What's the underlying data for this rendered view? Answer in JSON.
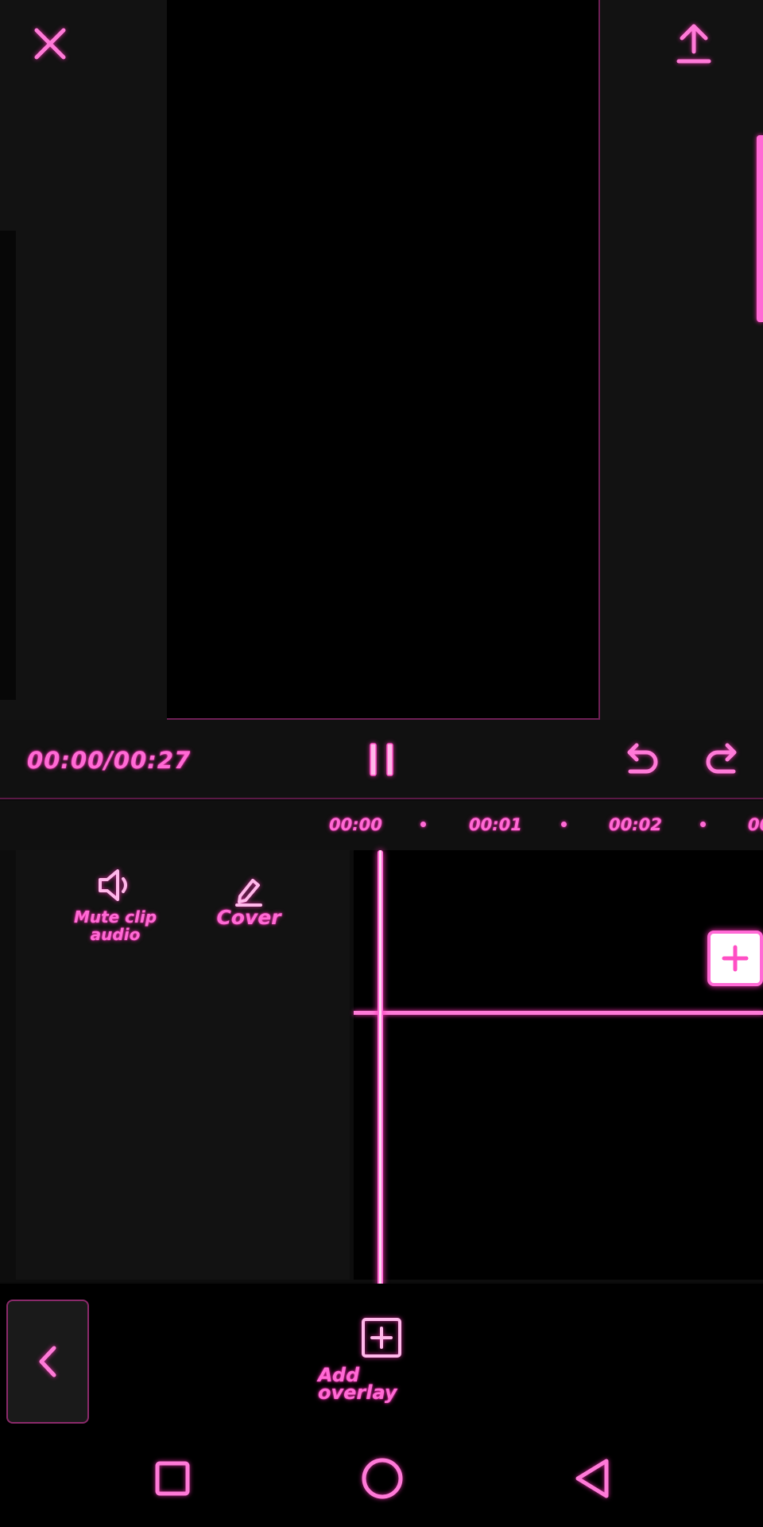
{
  "app": {
    "screen": "video-editor",
    "accent_color": "#ff6ad5",
    "background_color": "#0b0b0b"
  },
  "header": {
    "close_icon": "close-icon",
    "export_icon": "upload-icon"
  },
  "playback": {
    "time_display": "00:00/00:27",
    "current_time": "00:00",
    "total_time": "00:27",
    "pause_icon": "pause-icon",
    "undo_icon": "undo-icon",
    "redo_icon": "redo-icon"
  },
  "timeline": {
    "ruler_ticks": [
      "00:00",
      "00:01",
      "00:02",
      "00"
    ],
    "tools": [
      {
        "label": "Mute clip\naudio",
        "icon": "speaker-icon"
      },
      {
        "label": "Cover",
        "icon": "pencil-icon"
      }
    ],
    "add_clip_icon": "plus-icon"
  },
  "toolbar": {
    "back_icon": "chevron-left-icon",
    "add_overlay_label": "Add overlay",
    "add_overlay_icon": "plus-square-icon"
  },
  "nav": {
    "recents_icon": "square-icon",
    "home_icon": "circle-icon",
    "back_icon": "triangle-back-icon"
  }
}
